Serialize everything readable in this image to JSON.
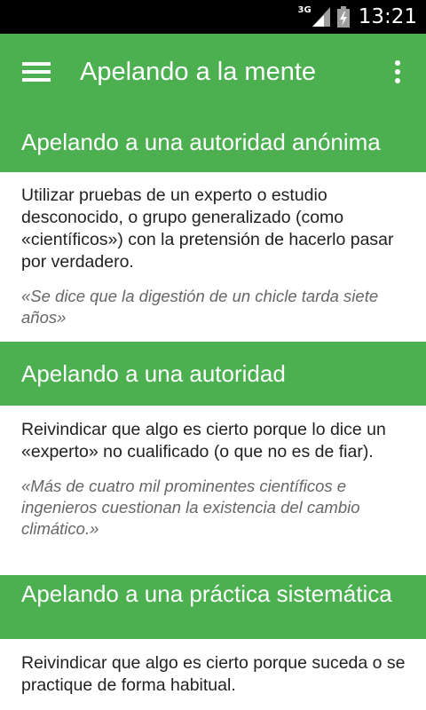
{
  "status_bar": {
    "network": "3G",
    "time": "13:21"
  },
  "app_bar": {
    "title": "Apelando a la mente"
  },
  "sections": [
    {
      "title": "Apelando a una autoridad anónima",
      "description": "Utilizar pruebas de un experto o estudio desconocido, o grupo generalizado (como «científicos») con la pretensión de hacerlo pasar por verdadero.",
      "example": "«Se dice que la digestión de un chicle tarda siete años»"
    },
    {
      "title": "Apelando a una autoridad",
      "description": "Reivindicar que algo es cierto porque lo dice un «experto» no cualificado (o que no es de fiar).",
      "example": "«Más de cuatro mil prominentes científicos e ingenieros cuestionan la existencia del cambio climático.»"
    },
    {
      "title": "Apelando a una práctica sistemática",
      "description": "Reivindicar que algo es cierto porque suceda o se practique de forma habitual.",
      "example": ""
    }
  ]
}
